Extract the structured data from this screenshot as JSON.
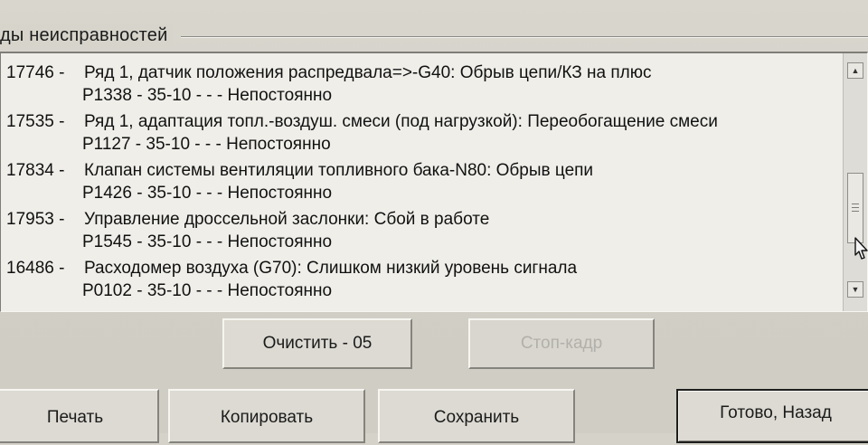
{
  "group": {
    "title": "ды неисправностей"
  },
  "faults": [
    {
      "code": "17746 -",
      "description": "Ряд 1, датчик положения распредвала=>-G40: Обрыв цепи/КЗ на плюс",
      "detail": "P1338 - 35-10 -   - - Непостоянно"
    },
    {
      "code": "17535 -",
      "description": "Ряд 1, адаптация топл.-воздуш. смеси (под нагрузкой): Переобогащение смеси",
      "detail": "P1127 - 35-10 -   - - Непостоянно"
    },
    {
      "code": "17834 -",
      "description": "Клапан системы вентиляции топливного бака-N80: Обрыв цепи",
      "detail": "P1426 - 35-10 -   - - Непостоянно"
    },
    {
      "code": "17953 -",
      "description": "Управление дроссельной заслонки: Сбой в работе",
      "detail": "P1545 - 35-10 -   - - Непостоянно"
    },
    {
      "code": "16486 -",
      "description": "Расходомер воздуха (G70): Слишком низкий уровень сигнала",
      "detail": "P0102 - 35-10 -   - - Непостоянно"
    }
  ],
  "buttons": {
    "clear": "Очистить - 05",
    "freeze_frame": "Стоп-кадр",
    "print": "Печать",
    "copy": "Копировать",
    "save": "Сохранить",
    "done_back": "Готово, Назад"
  },
  "icons": {
    "scroll_up": "scroll-up-arrow-icon",
    "scroll_down": "scroll-down-arrow-icon",
    "cursor": "mouse-pointer-icon"
  }
}
